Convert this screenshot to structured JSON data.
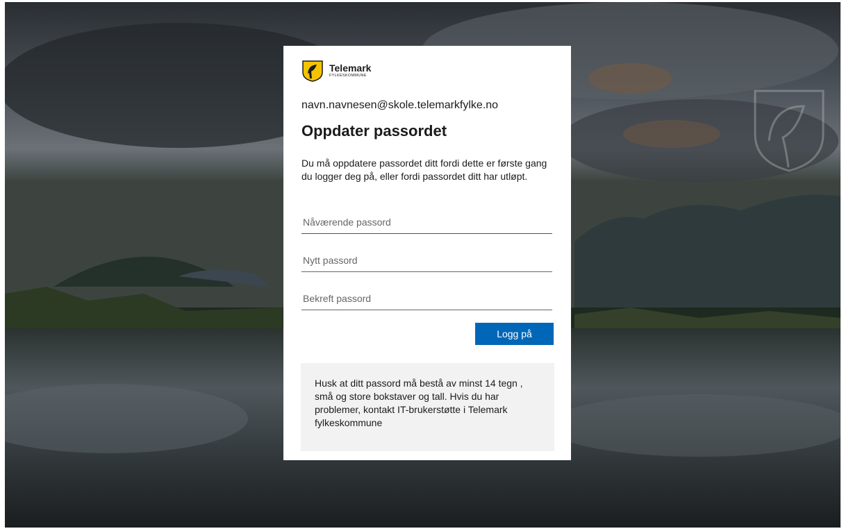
{
  "brand": {
    "name": "Telemark",
    "subtitle": "FYLKESKOMMUNE",
    "logo_icon": "telemark-shield-icon",
    "colors": {
      "shield_yellow": "#f5c400",
      "shield_black": "#1b1b1b"
    }
  },
  "account": {
    "email": "navn.navnesen@skole.telemarkfylke.no"
  },
  "form": {
    "title": "Oppdater passordet",
    "description": "Du må oppdatere passordet ditt fordi dette er første gang du logger deg på, eller fordi passordet ditt har utløpt.",
    "current_password": {
      "placeholder": "Nåværende passord",
      "value": ""
    },
    "new_password": {
      "placeholder": "Nytt passord",
      "value": ""
    },
    "confirm_password": {
      "placeholder": "Bekreft passord",
      "value": ""
    },
    "submit_label": "Logg på"
  },
  "notice": {
    "text": "Husk at ditt passord må bestå av minst 14 tegn , små og store bokstaver og tall. Hvis du har problemer, kontakt IT-brukerstøtte i Telemark fylkeskommune"
  },
  "background": {
    "watermark_icon": "telemark-crest-watermark-icon"
  },
  "colors": {
    "accent": "#0067b8",
    "notice_bg": "#f2f2f2",
    "card_bg": "#ffffff"
  }
}
